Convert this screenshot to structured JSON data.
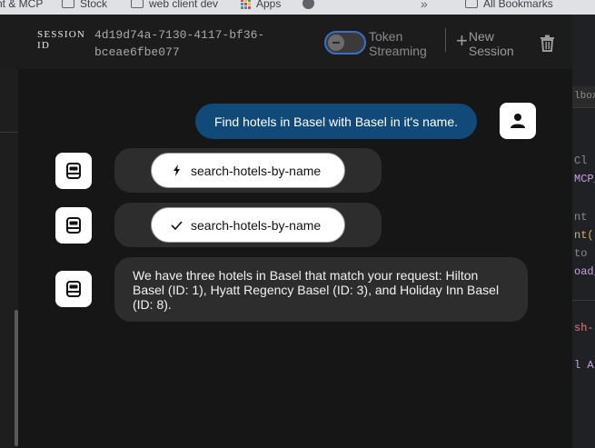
{
  "bookmarks": {
    "items": [
      {
        "label": "nt & MCP",
        "icon": "none"
      },
      {
        "label": "Stock",
        "icon": "folder-icon"
      },
      {
        "label": "web client dev",
        "icon": "folder-icon"
      },
      {
        "label": "Apps",
        "icon": "apps-grid-icon"
      },
      {
        "label": "",
        "icon": "globe-icon"
      }
    ],
    "overflow": "»",
    "all_bookmarks": "All Bookmarks"
  },
  "header": {
    "session_label": "SESSION ID",
    "session_id": "4d19d74a-7130-4117-bf36-bceae6fbe077",
    "token_streaming_label": "Token Streaming",
    "token_streaming_enabled": false,
    "new_session_label": "New Session"
  },
  "chat": {
    "user_message": "Find hotels in Basel with Basel in it's name.",
    "tool_calls": [
      {
        "name": "search-hotels-by-name",
        "status": "running",
        "icon": "lightning-icon"
      },
      {
        "name": "search-hotels-by-name",
        "status": "done",
        "icon": "checkmark-icon"
      }
    ],
    "assistant_message": "We have three hotels in Basel that match your request: Hilton Basel (ID: 1), Hyatt Regency Basel (ID: 3), and Holiday Inn Basel (ID: 8)."
  },
  "editor": {
    "tab_text": "lbox",
    "lines": [
      {
        "text": "Cl",
        "color": "#8c8c8c"
      },
      {
        "text": "MCP_",
        "color": "#c8a2e0"
      },
      {
        "text": "nt",
        "color": "#8c8c8c"
      },
      {
        "text": "nt(",
        "color": "#e0b060"
      },
      {
        "text": "to",
        "color": "#8c8c8c"
      },
      {
        "text": "oad_",
        "color": "#c8a2e0"
      },
      {
        "text": "sh-",
        "color": "#e07a7a"
      },
      {
        "text": "l A",
        "color": "#c8a2e0"
      }
    ]
  }
}
